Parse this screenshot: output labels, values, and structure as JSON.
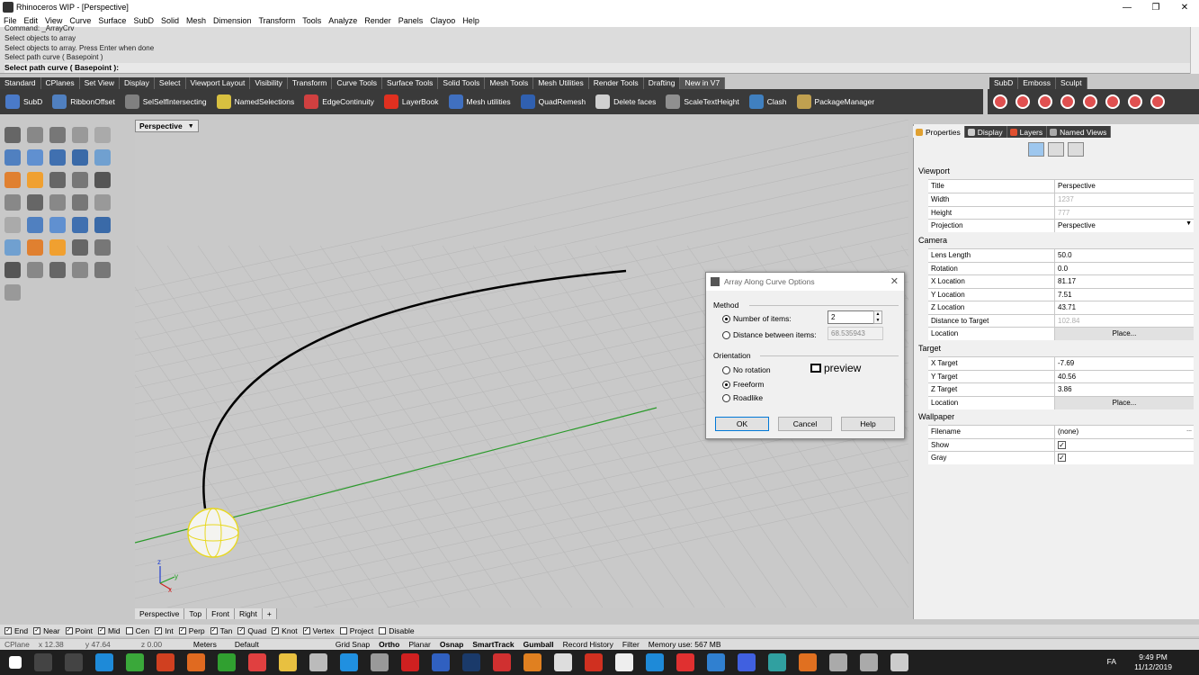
{
  "window": {
    "title": "Rhinoceros WIP - [Perspective]",
    "min": "—",
    "max": "❐",
    "close": "✕"
  },
  "menu": [
    "File",
    "Edit",
    "View",
    "Curve",
    "Surface",
    "SubD",
    "Solid",
    "Mesh",
    "Dimension",
    "Transform",
    "Tools",
    "Analyze",
    "Render",
    "Panels",
    "Clayoo",
    "Help"
  ],
  "command": {
    "lines": [
      "Command: _ArrayCrv",
      "Select objects to array",
      "Select objects to array. Press Enter when done",
      "Select path curve ( Basepoint )"
    ],
    "prompt": "Select path curve ( Basepoint ):"
  },
  "toolbar_tabs": [
    "Standard",
    "CPlanes",
    "Set View",
    "Display",
    "Select",
    "Viewport Layout",
    "Visibility",
    "Transform",
    "Curve Tools",
    "Surface Tools",
    "Solid Tools",
    "Mesh Tools",
    "Mesh Utilities",
    "Render Tools",
    "Drafting",
    "New in V7"
  ],
  "toolbar_tabs2": [
    "SubD",
    "Emboss",
    "Sculpt"
  ],
  "toolbar_buttons": [
    {
      "label": "SubD",
      "color": "#4a7ac8"
    },
    {
      "label": "RibbonOffset",
      "color": "#5080c0"
    },
    {
      "label": "SelSelfIntersecting",
      "color": "#808080"
    },
    {
      "label": "NamedSelections",
      "color": "#d8c040"
    },
    {
      "label": "EdgeContinuity",
      "color": "#d04040"
    },
    {
      "label": "LayerBook",
      "color": "#e03020"
    },
    {
      "label": "Mesh utilities",
      "color": "#4070c0"
    },
    {
      "label": "QuadRemesh",
      "color": "#3060b0"
    },
    {
      "label": "Delete faces",
      "color": "#d0d0d0"
    },
    {
      "label": "ScaleTextHeight",
      "color": "#909090"
    },
    {
      "label": "Clash",
      "color": "#4080c0"
    },
    {
      "label": "PackageManager",
      "color": "#c0a050"
    }
  ],
  "viewport": {
    "name": "Perspective",
    "tabs": [
      "Perspective",
      "Top",
      "Front",
      "Right"
    ],
    "add": "+",
    "axis_x": "x",
    "axis_y": "y",
    "axis_z": "z"
  },
  "dialog": {
    "title": "Array Along Curve Options",
    "close": "✕",
    "method_label": "Method",
    "number_label": "Number of items:",
    "number_value": "2",
    "distance_label": "Distance between items:",
    "distance_value": "68.535943",
    "orientation_label": "Orientation",
    "no_rotation": "No rotation",
    "freeform": "Freeform",
    "roadlike": "Roadlike",
    "preview": "preview",
    "ok": "OK",
    "cancel": "Cancel",
    "help": "Help"
  },
  "panel": {
    "tabs": [
      "Properties",
      "Display",
      "Layers",
      "Named Views"
    ],
    "viewport_h": "Viewport",
    "camera_h": "Camera",
    "target_h": "Target",
    "wallpaper_h": "Wallpaper",
    "viewport_rows": [
      {
        "k": "Title",
        "v": "Perspective"
      },
      {
        "k": "Width",
        "v": "1237"
      },
      {
        "k": "Height",
        "v": "777"
      },
      {
        "k": "Projection",
        "v": "Perspective"
      }
    ],
    "camera_rows": [
      {
        "k": "Lens Length",
        "v": "50.0"
      },
      {
        "k": "Rotation",
        "v": "0.0"
      },
      {
        "k": "X Location",
        "v": "81.17"
      },
      {
        "k": "Y Location",
        "v": "7.51"
      },
      {
        "k": "Z Location",
        "v": "43.71"
      },
      {
        "k": "Distance to Target",
        "v": "102.84"
      },
      {
        "k": "Location",
        "v": "Place..."
      }
    ],
    "target_rows": [
      {
        "k": "X Target",
        "v": "-7.69"
      },
      {
        "k": "Y Target",
        "v": "40.56"
      },
      {
        "k": "Z Target",
        "v": "3.86"
      },
      {
        "k": "Location",
        "v": "Place..."
      }
    ],
    "wallpaper_rows": [
      {
        "k": "Filename",
        "v": "(none)"
      },
      {
        "k": "Show",
        "v": "✓"
      },
      {
        "k": "Gray",
        "v": "✓"
      }
    ],
    "filename_more": "..."
  },
  "osnaps": [
    {
      "label": "End",
      "on": true
    },
    {
      "label": "Near",
      "on": true
    },
    {
      "label": "Point",
      "on": true
    },
    {
      "label": "Mid",
      "on": true
    },
    {
      "label": "Cen",
      "on": false
    },
    {
      "label": "Int",
      "on": true
    },
    {
      "label": "Perp",
      "on": true
    },
    {
      "label": "Tan",
      "on": true
    },
    {
      "label": "Quad",
      "on": true
    },
    {
      "label": "Knot",
      "on": true
    },
    {
      "label": "Vertex",
      "on": true
    },
    {
      "label": "Project",
      "on": false
    },
    {
      "label": "Disable",
      "on": false
    }
  ],
  "status": {
    "cplane": "CPlane",
    "x": "x 12.38",
    "y": "y 47.64",
    "z": "z 0.00",
    "units": "Meters",
    "layer": "Default",
    "grid_snap": "Grid Snap",
    "ortho": "Ortho",
    "planar": "Planar",
    "osnap": "Osnap",
    "smarttrack": "SmartTrack",
    "gumball": "Gumball",
    "record_history": "Record History",
    "filter": "Filter",
    "memory": "Memory use: 567 MB"
  },
  "taskbar": {
    "time": "9:49 PM",
    "date": "11/12/2019",
    "lang": "FA"
  }
}
